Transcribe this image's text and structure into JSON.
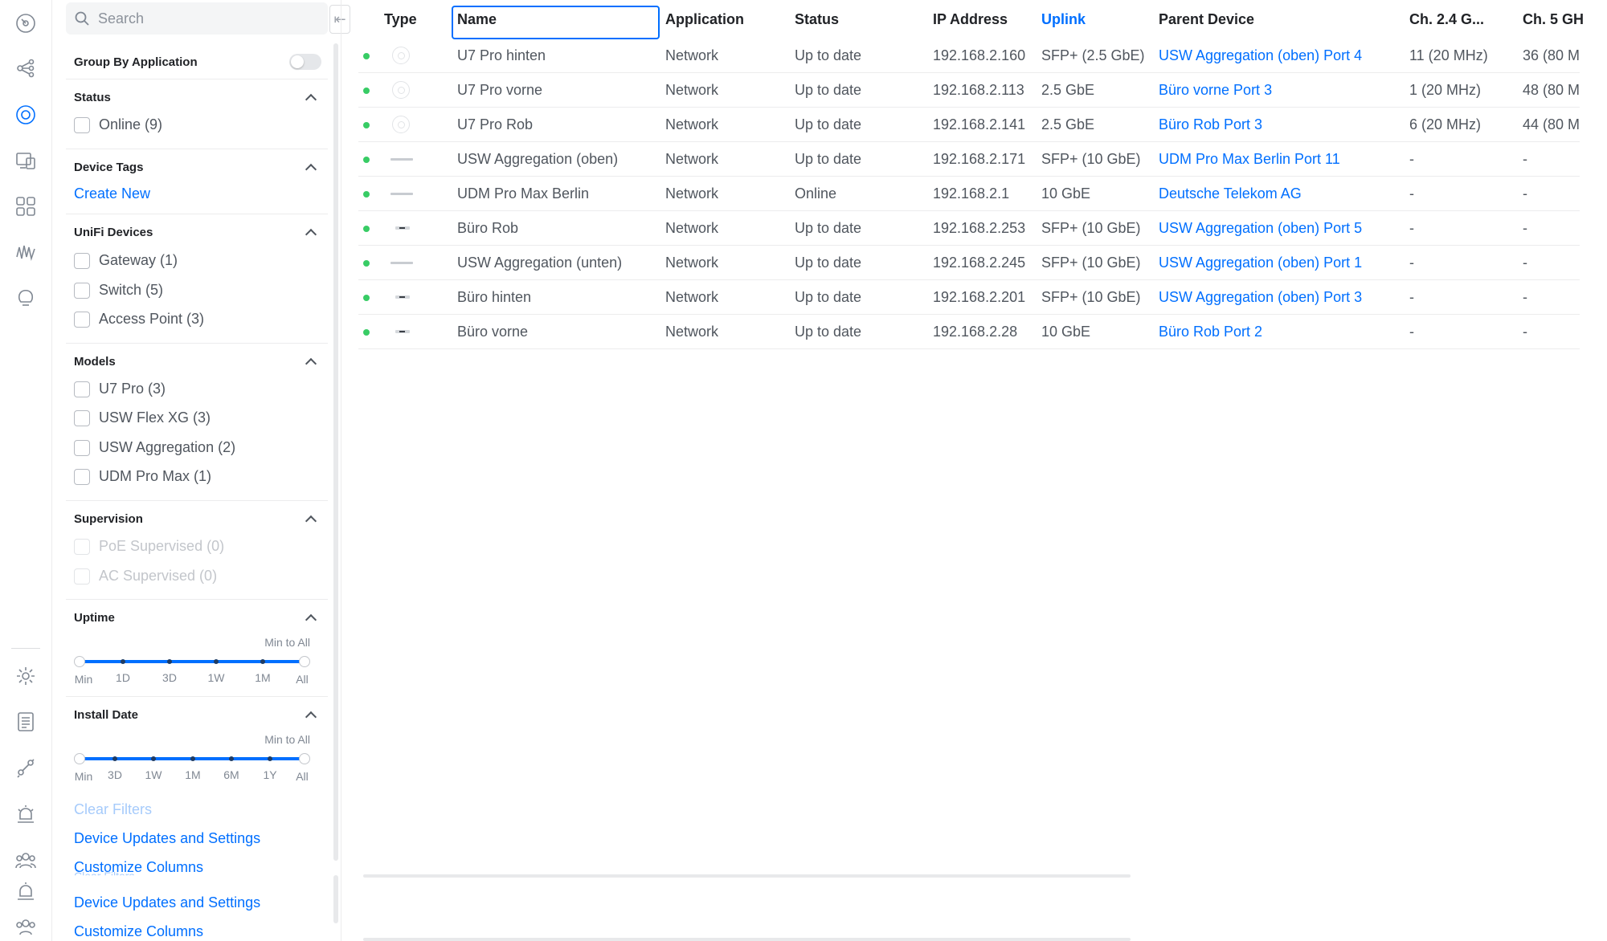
{
  "rail": {
    "icons": [
      "dashboard-icon",
      "topology-icon",
      "devices-icon",
      "client-devices-icon",
      "apps-icon",
      "insights-icon",
      "alarm-manager-icon",
      "settings-icon",
      "system-log-icon",
      "integrations-icon",
      "notifications-icon",
      "users-icon"
    ],
    "active": "devices-icon"
  },
  "filters": {
    "search_placeholder": "Search",
    "group_by_label": "Group By Application",
    "status": {
      "title": "Status",
      "options": [
        "Online (9)"
      ]
    },
    "tags": {
      "title": "Device Tags",
      "create_label": "Create New"
    },
    "unifi": {
      "title": "UniFi Devices",
      "options": [
        "Gateway (1)",
        "Switch (5)",
        "Access Point (3)"
      ]
    },
    "models": {
      "title": "Models",
      "options": [
        "U7 Pro (3)",
        "USW Flex XG (3)",
        "USW Aggregation (2)",
        "UDM Pro Max (1)"
      ]
    },
    "supervision": {
      "title": "Supervision",
      "options": [
        "PoE Supervised (0)",
        "AC Supervised (0)"
      ]
    },
    "uptime": {
      "title": "Uptime",
      "caption": "Min to All",
      "ticks": [
        "Min",
        "1D",
        "3D",
        "1W",
        "1M",
        "All"
      ]
    },
    "install": {
      "title": "Install Date",
      "caption": "Min to All",
      "ticks": [
        "Min",
        "3D",
        "1W",
        "1M",
        "6M",
        "1Y",
        "All"
      ]
    },
    "clear_label": "Clear Filters",
    "updates_label": "Device Updates and Settings",
    "columns_label": "Customize Columns"
  },
  "table": {
    "headers": [
      "Type",
      "Name",
      "Application",
      "Status",
      "IP Address",
      "Uplink",
      "Parent Device",
      "Ch. 2.4 G...",
      "Ch. 5 GH"
    ],
    "sorted_column": "Uplink",
    "rows": [
      {
        "type": "ap",
        "name": "U7 Pro hinten",
        "app": "Network",
        "status": "Up to date",
        "ip": "192.168.2.160",
        "uplink": "SFP+ (2.5 GbE)",
        "parent": "USW Aggregation (oben) Port 4",
        "ch24": "11 (20 MHz)",
        "ch5": "36 (80 M"
      },
      {
        "type": "ap",
        "name": "U7 Pro vorne",
        "app": "Network",
        "status": "Up to date",
        "ip": "192.168.2.113",
        "uplink": "2.5 GbE",
        "parent": "Büro vorne Port 3",
        "ch24": "1 (20 MHz)",
        "ch5": "48 (80 M"
      },
      {
        "type": "ap",
        "name": "U7 Pro Rob",
        "app": "Network",
        "status": "Up to date",
        "ip": "192.168.2.141",
        "uplink": "2.5 GbE",
        "parent": "Büro Rob Port 3",
        "ch24": "6 (20 MHz)",
        "ch5": "44 (80 M"
      },
      {
        "type": "switch",
        "name": "USW Aggregation (oben)",
        "app": "Network",
        "status": "Up to date",
        "ip": "192.168.2.171",
        "uplink": "SFP+ (10 GbE)",
        "parent": "UDM Pro Max Berlin Port 11",
        "ch24": "-",
        "ch5": "-"
      },
      {
        "type": "switch",
        "name": "UDM Pro Max Berlin",
        "app": "Network",
        "status": "Online",
        "ip": "192.168.2.1",
        "uplink": "10 GbE",
        "parent": "Deutsche Telekom AG",
        "ch24": "-",
        "ch5": "-"
      },
      {
        "type": "flex",
        "name": "Büro Rob",
        "app": "Network",
        "status": "Up to date",
        "ip": "192.168.2.253",
        "uplink": "SFP+ (10 GbE)",
        "parent": "USW Aggregation (oben) Port 5",
        "ch24": "-",
        "ch5": "-"
      },
      {
        "type": "switch",
        "name": "USW Aggregation (unten)",
        "app": "Network",
        "status": "Up to date",
        "ip": "192.168.2.245",
        "uplink": "SFP+ (10 GbE)",
        "parent": "USW Aggregation (oben) Port 1",
        "ch24": "-",
        "ch5": "-"
      },
      {
        "type": "flex",
        "name": "Büro hinten",
        "app": "Network",
        "status": "Up to date",
        "ip": "192.168.2.201",
        "uplink": "SFP+ (10 GbE)",
        "parent": "USW Aggregation (oben) Port 3",
        "ch24": "-",
        "ch5": "-"
      },
      {
        "type": "flex",
        "name": "Büro vorne",
        "app": "Network",
        "status": "Up to date",
        "ip": "192.168.2.28",
        "uplink": "10 GbE",
        "parent": "Büro Rob Port 2",
        "ch24": "-",
        "ch5": "-"
      }
    ]
  },
  "colors": {
    "accent": "#006fff",
    "online": "#38cc65"
  }
}
